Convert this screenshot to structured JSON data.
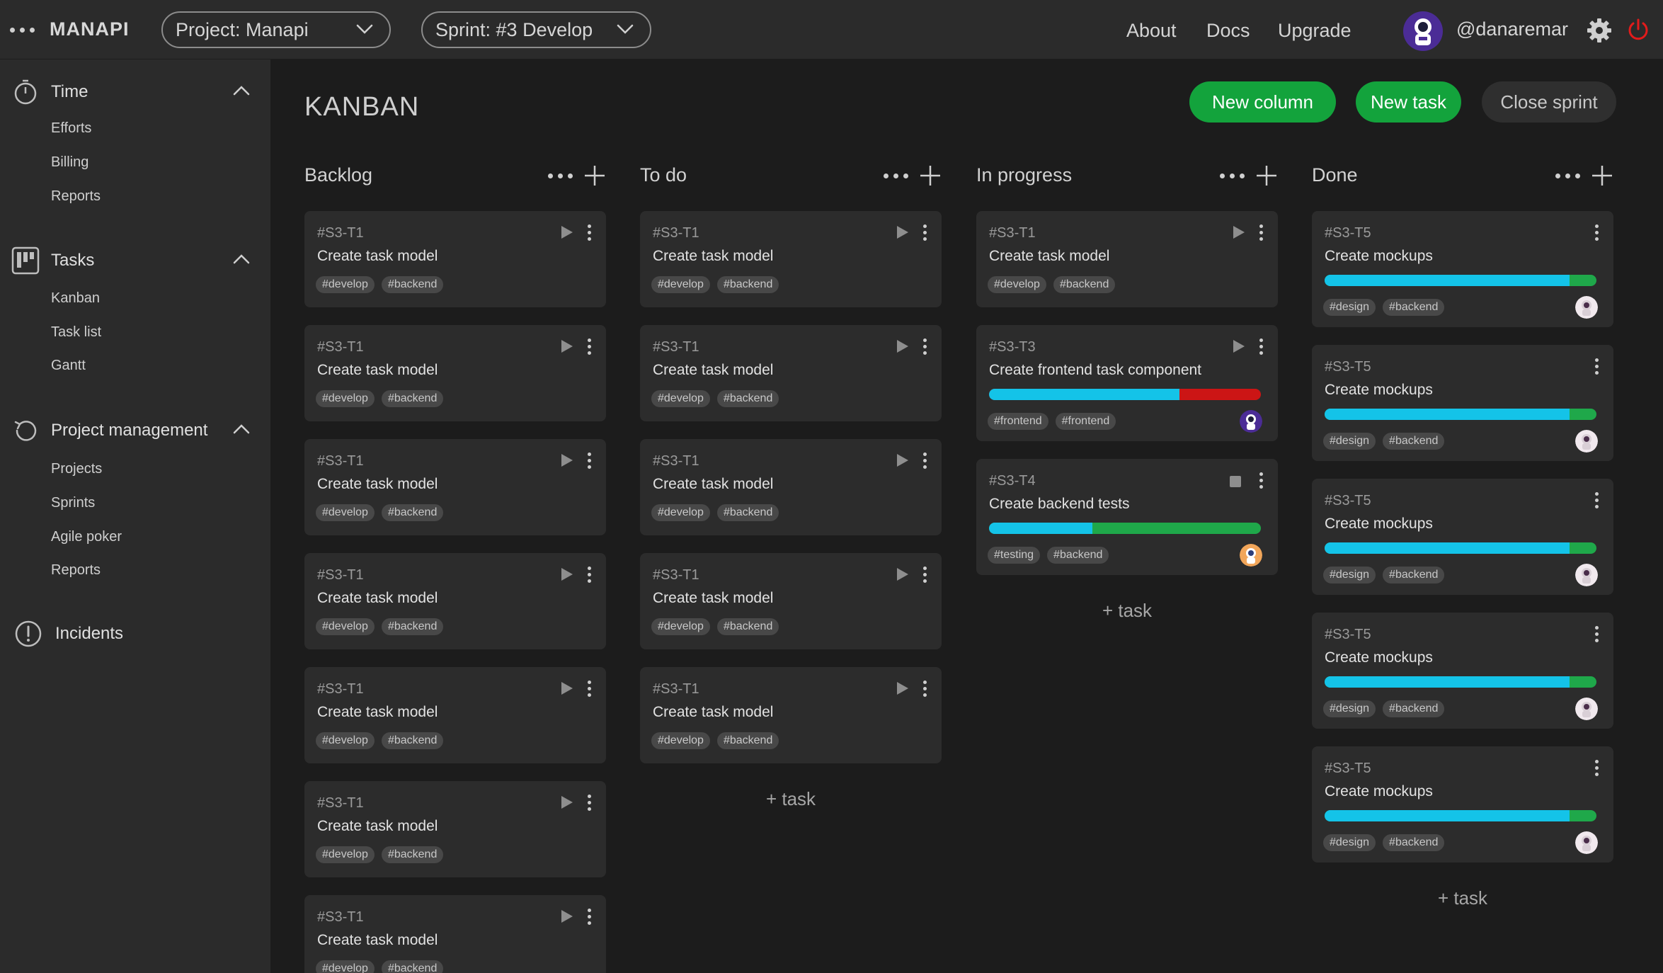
{
  "app": {
    "brand": "MANAPI"
  },
  "header": {
    "project_select": "Project: Manapi",
    "sprint_select": "Sprint: #3 Develop",
    "nav": [
      "About",
      "Docs",
      "Upgrade"
    ],
    "username": "@danaremar"
  },
  "sidebar": {
    "sections": [
      {
        "title": "Time",
        "items": [
          "Efforts",
          "Billing",
          "Reports"
        ]
      },
      {
        "title": "Tasks",
        "items": [
          "Kanban",
          "Task list",
          "Gantt"
        ]
      },
      {
        "title": "Project management",
        "items": [
          "Projects",
          "Sprints",
          "Agile poker",
          "Reports"
        ]
      },
      {
        "title": "Incidents",
        "items": []
      }
    ]
  },
  "page": {
    "title": "KANBAN",
    "buttons": {
      "new_column": "New column",
      "new_task": "New task",
      "close_sprint": "Close sprint"
    },
    "add_task_label": "+ task"
  },
  "colors": {
    "green": "#13a33c",
    "progress_blue": "#14c3e8",
    "progress_green": "#1fa84a",
    "progress_red": "#cc1515",
    "card_bg": "#2c2c2c",
    "sidebar_bg": "#2b2b2b"
  },
  "columns": [
    {
      "title": "Backlog",
      "cards": [
        {
          "id": "#S3-T1",
          "name": "Create task model",
          "tags": [
            "#develop",
            "#backend"
          ],
          "action": "play"
        },
        {
          "id": "#S3-T1",
          "name": "Create task model",
          "tags": [
            "#develop",
            "#backend"
          ],
          "action": "play"
        },
        {
          "id": "#S3-T1",
          "name": "Create task model",
          "tags": [
            "#develop",
            "#backend"
          ],
          "action": "play"
        },
        {
          "id": "#S3-T1",
          "name": "Create task model",
          "tags": [
            "#develop",
            "#backend"
          ],
          "action": "play"
        },
        {
          "id": "#S3-T1",
          "name": "Create task model",
          "tags": [
            "#develop",
            "#backend"
          ],
          "action": "play"
        },
        {
          "id": "#S3-T1",
          "name": "Create task model",
          "tags": [
            "#develop",
            "#backend"
          ],
          "action": "play"
        },
        {
          "id": "#S3-T1",
          "name": "Create task model",
          "tags": [
            "#develop",
            "#backend"
          ],
          "action": "play"
        }
      ]
    },
    {
      "title": "To do",
      "cards": [
        {
          "id": "#S3-T1",
          "name": "Create task model",
          "tags": [
            "#develop",
            "#backend"
          ],
          "action": "play"
        },
        {
          "id": "#S3-T1",
          "name": "Create task model",
          "tags": [
            "#develop",
            "#backend"
          ],
          "action": "play"
        },
        {
          "id": "#S3-T1",
          "name": "Create task model",
          "tags": [
            "#develop",
            "#backend"
          ],
          "action": "play"
        },
        {
          "id": "#S3-T1",
          "name": "Create task model",
          "tags": [
            "#develop",
            "#backend"
          ],
          "action": "play"
        },
        {
          "id": "#S3-T1",
          "name": "Create task model",
          "tags": [
            "#develop",
            "#backend"
          ],
          "action": "play"
        }
      ]
    },
    {
      "title": "In progress",
      "cards": [
        {
          "id": "#S3-T1",
          "name": "Create task model",
          "tags": [
            "#develop",
            "#backend"
          ],
          "action": "play"
        },
        {
          "id": "#S3-T3",
          "name": "Create frontend task component",
          "tags": [
            "#frontend",
            "#frontend"
          ],
          "action": "play",
          "progress": {
            "done": 0.7,
            "rest_color": "red"
          },
          "assignee": "astronaut-purple"
        },
        {
          "id": "#S3-T4",
          "name": "Create backend tests",
          "tags": [
            "#testing",
            "#backend"
          ],
          "action": "stop",
          "progress": {
            "done": 0.38,
            "rest_color": "green"
          },
          "assignee": "astronaut-orange"
        }
      ]
    },
    {
      "title": "Done",
      "cards": [
        {
          "id": "#S3-T5",
          "name": "Create mockups",
          "tags": [
            "#design",
            "#backend"
          ],
          "action": "none",
          "progress": {
            "done": 0.9,
            "rest_color": "green"
          },
          "assignee": "astronaut-white"
        },
        {
          "id": "#S3-T5",
          "name": "Create mockups",
          "tags": [
            "#design",
            "#backend"
          ],
          "action": "none",
          "progress": {
            "done": 0.9,
            "rest_color": "green"
          },
          "assignee": "astronaut-white"
        },
        {
          "id": "#S3-T5",
          "name": "Create mockups",
          "tags": [
            "#design",
            "#backend"
          ],
          "action": "none",
          "progress": {
            "done": 0.9,
            "rest_color": "green"
          },
          "assignee": "astronaut-white"
        },
        {
          "id": "#S3-T5",
          "name": "Create mockups",
          "tags": [
            "#design",
            "#backend"
          ],
          "action": "none",
          "progress": {
            "done": 0.9,
            "rest_color": "green"
          },
          "assignee": "astronaut-white"
        },
        {
          "id": "#S3-T5",
          "name": "Create mockups",
          "tags": [
            "#design",
            "#backend"
          ],
          "action": "none",
          "progress": {
            "done": 0.9,
            "rest_color": "green"
          },
          "assignee": "astronaut-white"
        }
      ]
    }
  ]
}
